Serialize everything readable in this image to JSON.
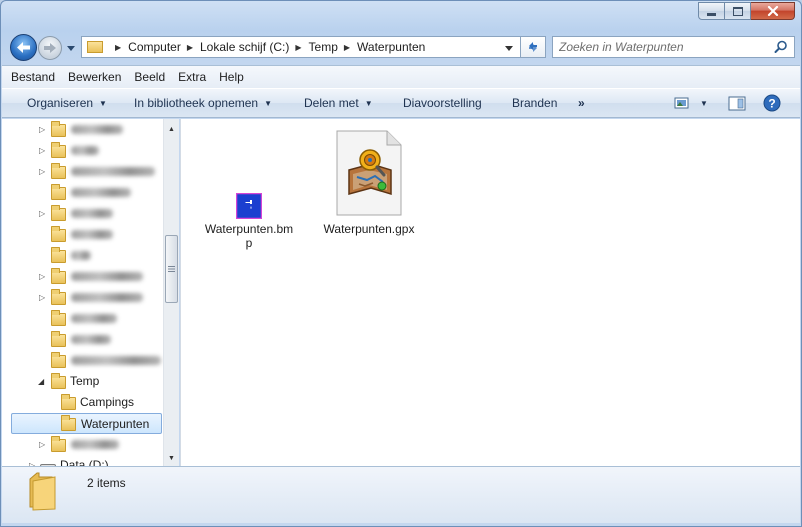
{
  "window": {
    "accent": "#2a6fc2"
  },
  "caption_buttons": [
    {
      "name": "minimize-icon"
    },
    {
      "name": "maximize-icon"
    },
    {
      "name": "close-icon"
    }
  ],
  "address": {
    "crumbs": [
      "Computer",
      "Lokale schijf (C:)",
      "Temp",
      "Waterpunten"
    ]
  },
  "search": {
    "placeholder": "Zoeken in Waterpunten"
  },
  "menu": [
    "Bestand",
    "Bewerken",
    "Beeld",
    "Extra",
    "Help"
  ],
  "commands": {
    "organize": "Organiseren",
    "library": "In bibliotheek opnemen",
    "share": "Delen met",
    "slideshow": "Diavoorstelling",
    "burn": "Branden",
    "more": "»"
  },
  "tree": {
    "temp": "Temp",
    "campings": "Campings",
    "waterpunten": "Waterpunten",
    "data_drive": "Data (D:)"
  },
  "files": [
    {
      "name_line1": "Waterpunten.bm",
      "name_line2": "p",
      "icon": "bmp-image-icon"
    },
    {
      "name_line1": "Waterpunten.gpx",
      "name_line2": "",
      "icon": "gpx-map-icon"
    }
  ],
  "status": {
    "item_count": "2 items"
  }
}
